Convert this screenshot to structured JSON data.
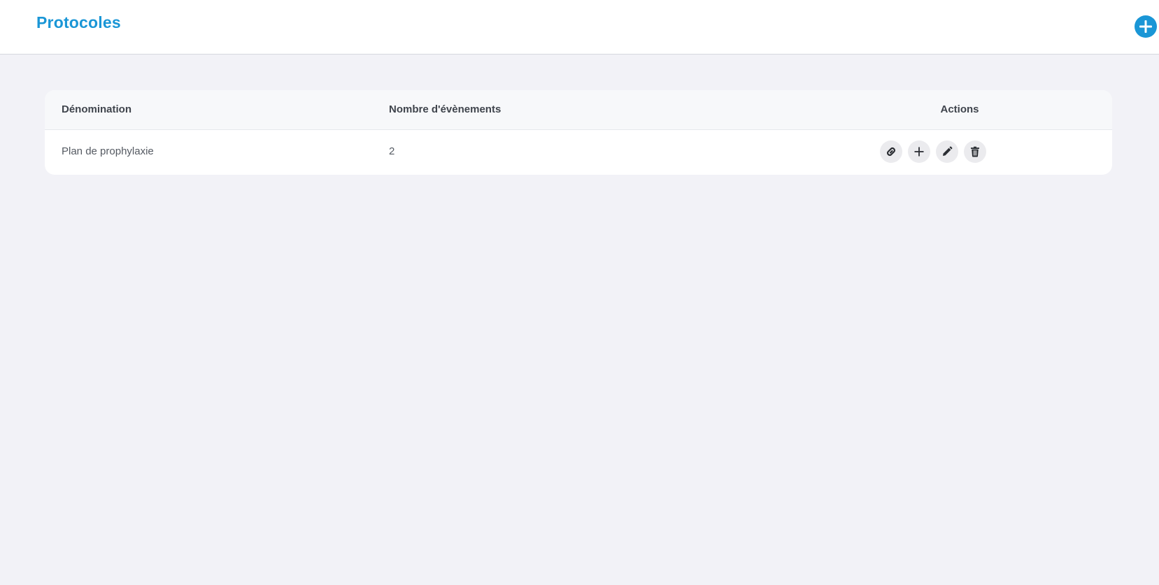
{
  "header": {
    "title": "Protocoles",
    "add_icon": "plus-circle-icon"
  },
  "colors": {
    "accent": "#1a96d6",
    "background": "#f2f2f7",
    "card": "#ffffff",
    "action_button_bg": "#ebebee"
  },
  "table": {
    "columns": [
      "Dénomination",
      "Nombre d'évènements",
      "Actions"
    ],
    "rows": [
      {
        "name": "Plan de prophylaxie",
        "event_count": "2",
        "actions": [
          "link-icon",
          "plus-icon",
          "pencil-icon",
          "trash-icon"
        ]
      }
    ]
  }
}
